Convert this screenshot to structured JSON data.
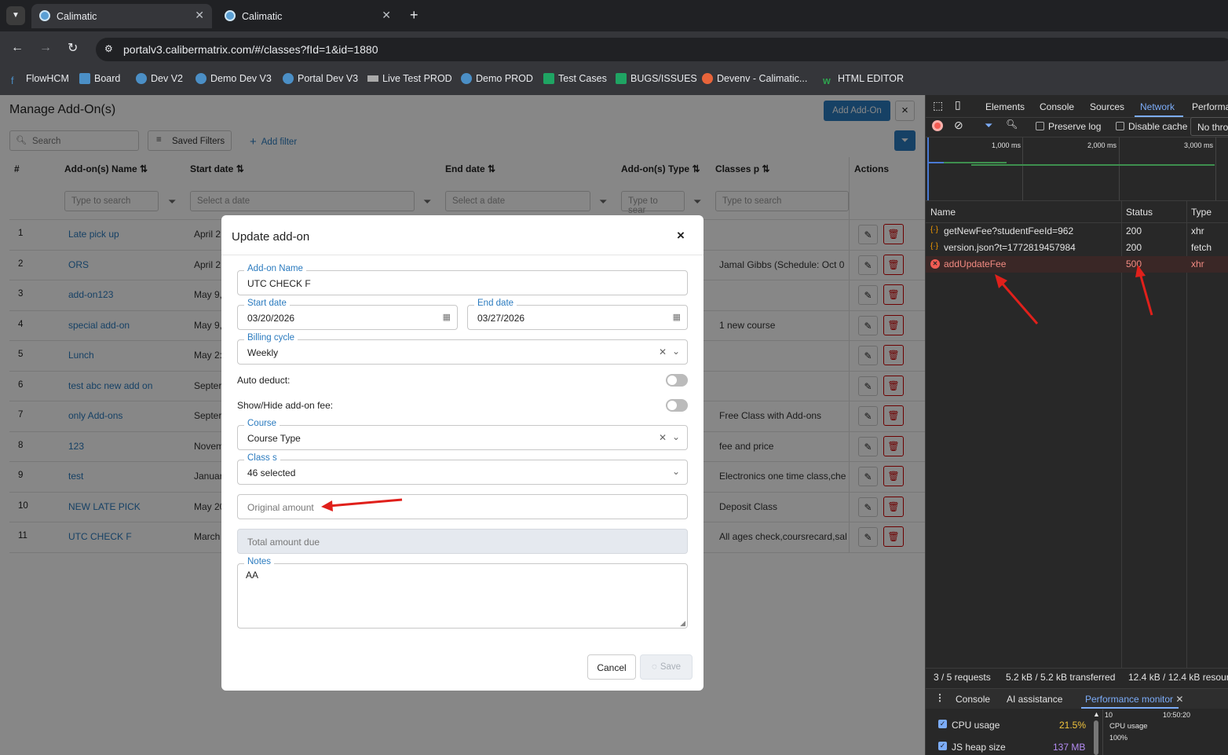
{
  "browser": {
    "tabs": [
      {
        "title": "Calimatic"
      },
      {
        "title": "Calimatic"
      }
    ],
    "url": "portalv3.calibermatrix.com/#/classes?fId=1&id=1880",
    "bookmarks": [
      "FlowHCM",
      "Board",
      "Dev V2",
      "Demo Dev V3",
      "Portal Dev V3",
      "Live Test PROD",
      "Demo PROD",
      "Test Cases",
      "BUGS/ISSUES",
      "Devenv - Calimatic...",
      "HTML EDITOR"
    ]
  },
  "page": {
    "title": "Manage Add-On(s)",
    "add_button": "Add Add-On",
    "close": "×",
    "search_placeholder": "Search",
    "saved_filters": "Saved Filters",
    "add_filter": "Add filter",
    "columns": [
      "#",
      "Add-on(s) Name",
      "Start date",
      "End date",
      "Add-on(s) Type",
      "Classes p",
      "Actions"
    ],
    "filter_placeholders": [
      "Type to search",
      "Select a date",
      "Select a date",
      "Type to sear",
      "Type to search"
    ],
    "rows": [
      {
        "n": "1",
        "name": "Late pick up",
        "start": "April 2",
        "classes": ""
      },
      {
        "n": "2",
        "name": "ORS",
        "start": "April 2",
        "classes": "Jamal Gibbs (Schedule: Oct 0"
      },
      {
        "n": "3",
        "name": "add-on123",
        "start": "May 9,",
        "classes": ""
      },
      {
        "n": "4",
        "name": "special add-on",
        "start": "May 9,",
        "classes": "1 new course"
      },
      {
        "n": "5",
        "name": "Lunch",
        "start": "May 2:",
        "classes": ""
      },
      {
        "n": "6",
        "name": "test abc new add on",
        "start": "Septer",
        "classes": ""
      },
      {
        "n": "7",
        "name": "only Add-ons",
        "start": "Septer",
        "classes": "Free Class with Add-ons"
      },
      {
        "n": "8",
        "name": "123",
        "start": "Novem",
        "classes": "fee and price"
      },
      {
        "n": "9",
        "name": "test",
        "start": "Januar",
        "classes": "Electronics one time class,che"
      },
      {
        "n": "10",
        "name": "NEW LATE PICK",
        "start": "May 20",
        "classes": "Deposit Class"
      },
      {
        "n": "11",
        "name": "UTC CHECK F",
        "start": "March",
        "classes": "All ages check,coursrecard,sal"
      }
    ]
  },
  "modal": {
    "title": "Update add-on",
    "close": "×",
    "addon_name_label": "Add-on Name",
    "addon_name": "UTC CHECK F",
    "start_label": "Start date",
    "start_value": "03/20/2026",
    "end_label": "End date",
    "end_value": "03/27/2026",
    "billing_label": "Billing cycle",
    "billing_value": "Weekly",
    "auto_deduct": "Auto deduct:",
    "show_hide": "Show/Hide add-on fee:",
    "course_label": "Course",
    "course_value": "Course Type",
    "class_label": "Class s",
    "class_value": "46 selected",
    "original_amount": "Original amount",
    "total_due": "Total amount due",
    "notes_label": "Notes",
    "notes_value": "AA",
    "cancel": "Cancel",
    "save": "Save"
  },
  "devtools": {
    "tabs": [
      "Elements",
      "Console",
      "Sources",
      "Network",
      "Performa"
    ],
    "preserve_log": "Preserve log",
    "disable_cache": "Disable cache",
    "throttle": "No thro",
    "timeline": [
      "1,000 ms",
      "2,000 ms",
      "3,000 ms"
    ],
    "cols": [
      "Name",
      "Status",
      "Type"
    ],
    "requests": [
      {
        "name": "getNewFee?studentFeeId=962",
        "status": "200",
        "type": "xhr",
        "error": false
      },
      {
        "name": "version.json?t=1772819457984",
        "status": "200",
        "type": "fetch",
        "error": false
      },
      {
        "name": "addUpdateFee",
        "status": "500",
        "type": "xhr",
        "error": true
      }
    ],
    "summary": [
      "3 / 5 requests",
      "5.2 kB / 5.2 kB transferred",
      "12.4 kB / 12.4 kB resourc"
    ],
    "drawer_tabs": [
      "Console",
      "AI assistance",
      "Performance monitor"
    ],
    "cpu_label": "CPU usage",
    "cpu_value": "21.5%",
    "heap_label": "JS heap size",
    "heap_value": "137 MB",
    "graph_time": "10:50:20",
    "graph_label": "CPU usage",
    "graph_pct": "100%",
    "graph_num": "10"
  },
  "colors": {
    "accent": "#2b7bbf",
    "error": "#f25c54",
    "annotation": "#e0201b"
  }
}
